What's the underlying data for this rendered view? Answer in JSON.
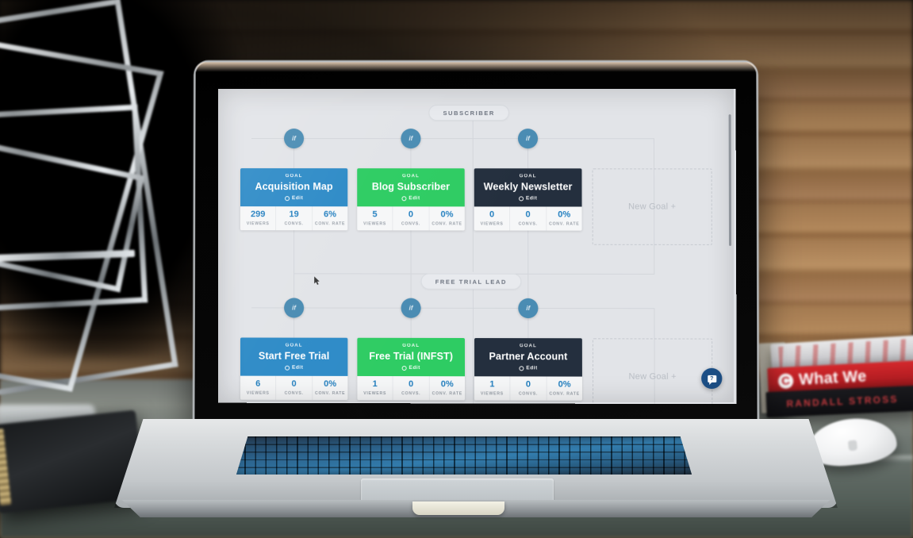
{
  "scene": {
    "device": "macbook-pro",
    "desk_objects": {
      "book_red_title": "What We",
      "book_red_badge": "C",
      "book_black_author": "RANDALL STROSS"
    }
  },
  "app": {
    "background_color": "#e2e4e8",
    "accent_blue": "#2e8bc7",
    "accent_green": "#2ecc63",
    "accent_dark": "#242f3e",
    "node_blue": "#4a8cb3",
    "stat_value_color": "#2480c0",
    "rows": [
      {
        "pill_label": "SUBSCRIBER",
        "if_label": "if",
        "goals": [
          {
            "kind": "GOAL",
            "title": "Acquisition Map",
            "edit_label": "Edit",
            "color": "#2e8bc7",
            "stats": [
              {
                "value": "299",
                "label": "VIEWERS"
              },
              {
                "value": "19",
                "label": "CONVS."
              },
              {
                "value": "6%",
                "label": "CONV. RATE"
              }
            ]
          },
          {
            "kind": "GOAL",
            "title": "Blog Subscriber",
            "edit_label": "Edit",
            "color": "#2ecc63",
            "stats": [
              {
                "value": "5",
                "label": "VIEWERS"
              },
              {
                "value": "0",
                "label": "CONVS."
              },
              {
                "value": "0%",
                "label": "CONV. RATE"
              }
            ]
          },
          {
            "kind": "GOAL",
            "title": "Weekly Newsletter",
            "edit_label": "Edit",
            "color": "#242f3e",
            "stats": [
              {
                "value": "0",
                "label": "VIEWERS"
              },
              {
                "value": "0",
                "label": "CONVS."
              },
              {
                "value": "0%",
                "label": "CONV. RATE"
              }
            ]
          }
        ],
        "new_goal_label": "New Goal +"
      },
      {
        "pill_label": "FREE TRIAL LEAD",
        "if_label": "if",
        "goals": [
          {
            "kind": "GOAL",
            "title": "Start Free Trial",
            "edit_label": "Edit",
            "color": "#2e8bc7",
            "stats": [
              {
                "value": "6",
                "label": "VIEWERS"
              },
              {
                "value": "0",
                "label": "CONVS."
              },
              {
                "value": "0%",
                "label": "CONV. RATE"
              }
            ]
          },
          {
            "kind": "GOAL",
            "title": "Free Trial (INFST)",
            "edit_label": "Edit",
            "color": "#2ecc63",
            "stats": [
              {
                "value": "1",
                "label": "VIEWERS"
              },
              {
                "value": "0",
                "label": "CONVS."
              },
              {
                "value": "0%",
                "label": "CONV. RATE"
              }
            ]
          },
          {
            "kind": "GOAL",
            "title": "Partner Account",
            "edit_label": "Edit",
            "color": "#242f3e",
            "stats": [
              {
                "value": "1",
                "label": "VIEWERS"
              },
              {
                "value": "0",
                "label": "CONVS."
              },
              {
                "value": "0%",
                "label": "CONV. RATE"
              }
            ]
          }
        ],
        "new_goal_label": "New Goal +"
      }
    ],
    "chat_widget": {
      "icon": "chat-bubble-icon"
    },
    "scrollbar": {
      "icon": "vertical-scrollbar"
    }
  }
}
